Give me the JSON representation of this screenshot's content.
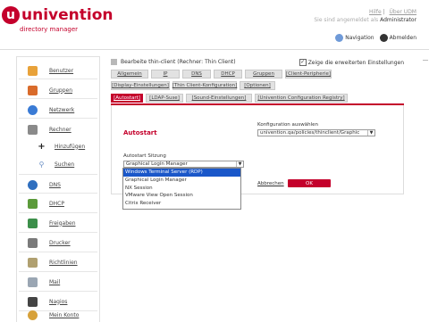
{
  "brand": {
    "logo_letter": "u",
    "name": "univention",
    "subtitle": "directory manager"
  },
  "toplinks": {
    "help": "Hilfe",
    "about": "Über UDM"
  },
  "login": {
    "prefix": "Sie sind angemeldet als",
    "user": "Administrator"
  },
  "header_nav": {
    "navigation": "Navigation",
    "logout": "Abmelden"
  },
  "sidebar": {
    "items": [
      {
        "label": "Benutzer",
        "icon": "user-icon",
        "color": "#e8a23a"
      },
      {
        "label": "Gruppen",
        "icon": "group-icon",
        "color": "#d96b2b"
      },
      {
        "label": "Netzwerk",
        "icon": "network-icon",
        "color": "#3a7bd5"
      },
      {
        "label": "Rechner",
        "icon": "computer-icon",
        "color": "#8a8a8a"
      },
      {
        "label": "Hinzufügen",
        "icon": "plus-icon",
        "color": "#222222"
      },
      {
        "label": "Suchen",
        "icon": "magnifier-icon",
        "color": "#6a8fc4"
      },
      {
        "label": "DNS",
        "icon": "globe-icon",
        "color": "#2f6fbf"
      },
      {
        "label": "DHCP",
        "icon": "dhcp-icon",
        "color": "#5b9a3a"
      },
      {
        "label": "Freigaben",
        "icon": "share-icon",
        "color": "#3c8f4a"
      },
      {
        "label": "Drucker",
        "icon": "printer-icon",
        "color": "#7a7a7a"
      },
      {
        "label": "Richtlinien",
        "icon": "policy-icon",
        "color": "#b0a070"
      },
      {
        "label": "Mail",
        "icon": "mail-icon",
        "color": "#9aa6b3"
      },
      {
        "label": "Nagios",
        "icon": "nagios-icon",
        "color": "#444444"
      },
      {
        "label": "Mein Konto",
        "icon": "account-icon",
        "color": "#d7a13a"
      }
    ]
  },
  "main": {
    "title": "Bearbeite thin-client (Rechner: Thin Client)",
    "show_extended": "Zeige die erweiterten Einstellungen",
    "tabs_row1": [
      "Allgemein",
      "IP",
      "DNS",
      "DHCP",
      "Gruppen",
      "[Client-Peripherie]"
    ],
    "tabs_row2": [
      "[Display-Einstellungen]",
      "[Thin Client-Konfiguration]",
      "[Optionen]"
    ],
    "tabs_row3": [
      "[Autostart]",
      "[LDAP-Suse]",
      "[Sound-Einstellungen]",
      "[Univention Configuration Registry]"
    ],
    "section_title": "Autostart",
    "config_label": "Konfiguration auswählen",
    "config_value": "univention.qa/policies/thinclient/Graphic",
    "session_label": "Autostart Sitzung",
    "session_value": "Graphical Login Manager",
    "cancel": "Abbrechen",
    "ok": "OK"
  },
  "dropdown": {
    "options": [
      "Windows Terminal Server (RDP)",
      "Graphical Login Manager",
      "NX Session",
      "VMware View Open Session",
      "Citrix Receiver"
    ],
    "selected_index": 0
  },
  "colors": {
    "accent": "#c4002b",
    "selection": "#1a57c9"
  }
}
